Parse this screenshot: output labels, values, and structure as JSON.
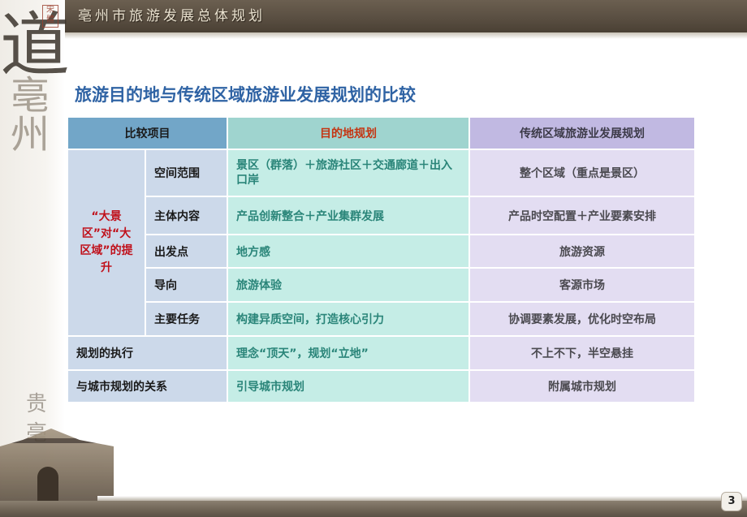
{
  "banner": {
    "title": "亳州市旅游发展总体规划"
  },
  "side": {
    "calligraphy_main": "道",
    "calligraphy_sub": "亳州",
    "seal": "宋體",
    "lower_text": "贵亳"
  },
  "heading": "旅游目的地与传统区域旅游业发展规划的比较",
  "table": {
    "headers": [
      "比较项目",
      "目的地规划",
      "传统区域旅游业发展规划"
    ],
    "group_label": "“大景区”对“大区域”的提升",
    "group_rows": [
      {
        "item": "空间范围",
        "destination": "景区（群落）＋旅游社区＋交通廊道＋出入口岸",
        "traditional": "整个区域（重点是景区）"
      },
      {
        "item": "主体内容",
        "destination": "产品创新整合＋产业集群发展",
        "traditional": "产品时空配置＋产业要素安排"
      },
      {
        "item": "出发点",
        "destination": "地方感",
        "traditional": "旅游资源"
      },
      {
        "item": "导向",
        "destination": "旅游体验",
        "traditional": "客源市场"
      },
      {
        "item": "主要任务",
        "destination": "构建异质空间，打造核心引力",
        "traditional": "协调要素发展，优化时空布局"
      }
    ],
    "extra_rows": [
      {
        "item": "规划的执行",
        "destination": "理念“顶天”，规划“立地”",
        "traditional": "不上不下，半空悬挂"
      },
      {
        "item": "与城市规划的关系",
        "destination": "引导城市规划",
        "traditional": "附属城市规划"
      }
    ]
  },
  "page_number": "3",
  "colors": {
    "banner": "#5a4f42",
    "heading": "#2f63a4",
    "header_col1": "#72a6c8",
    "header_col2": "#9fd4cf",
    "header_col3": "#c1b9e2",
    "group_label": "#c0111b",
    "destination_text": "#2a8579"
  }
}
